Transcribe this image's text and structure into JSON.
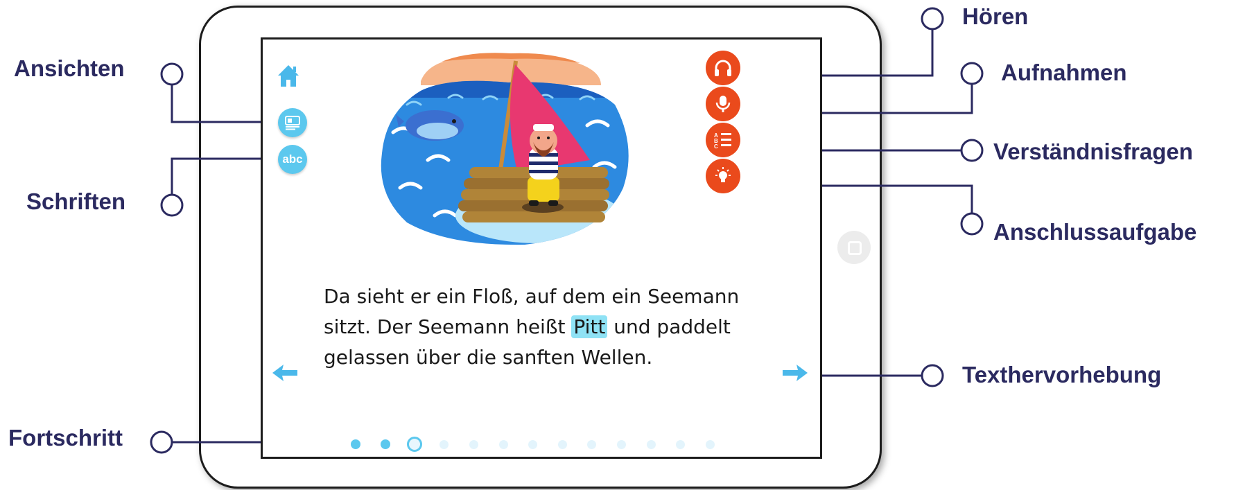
{
  "callouts": {
    "ansichten": "Ansichten",
    "schriften": "Schriften",
    "fortschritt": "Fortschritt",
    "hoeren": "Hören",
    "aufnahmen": "Aufnahmen",
    "verstaendnisfragen": "Verständnisfragen",
    "anschlussaufgabe": "Anschlussaufgabe",
    "texthervorhebung": "Texthervorhebung"
  },
  "toolbar": {
    "fonts_label": "abc"
  },
  "story": {
    "line1": "Da sieht er ein Floß, auf dem ein Seemann",
    "line2_before": "sitzt. Der Seemann heißt ",
    "highlighted_word": "Pitt",
    "line2_after": " und paddelt",
    "line3": "gelassen über die sanften Wellen."
  },
  "progress": {
    "total_pages": 13,
    "completed": 2,
    "current": 3
  },
  "colors": {
    "accent_blue": "#5cc8ee",
    "accent_orange": "#ea4a1c",
    "callout_text": "#2b2a60",
    "highlight": "#8fe2f5"
  },
  "icons": [
    "home-icon",
    "views-icon",
    "fonts-icon",
    "headphones-icon",
    "microphone-icon",
    "quiz-icon",
    "lightbulb-icon",
    "arrow-left-icon",
    "arrow-right-icon"
  ]
}
